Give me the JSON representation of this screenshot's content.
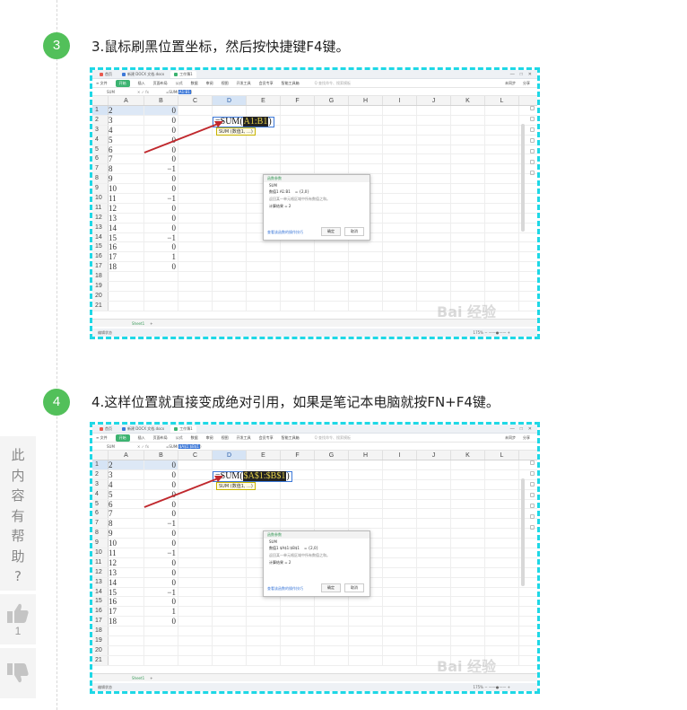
{
  "steps": [
    {
      "number": "3",
      "text": "3.鼠标刷黑位置坐标，然后按快捷键F4键。"
    },
    {
      "number": "4",
      "text": "4.这样位置就直接变成绝对引用，如果是笔记本电脑就按FN+F4键。"
    }
  ],
  "sheet": {
    "columns": [
      "A",
      "B",
      "C",
      "D",
      "E",
      "F",
      "G",
      "H",
      "I",
      "J",
      "K",
      "L"
    ],
    "rows": [
      {
        "n": "1",
        "a": "2",
        "b": "0"
      },
      {
        "n": "2",
        "a": "3",
        "b": "0"
      },
      {
        "n": "3",
        "a": "4",
        "b": "0"
      },
      {
        "n": "4",
        "a": "5",
        "b": "0"
      },
      {
        "n": "5",
        "a": "6",
        "b": "0"
      },
      {
        "n": "6",
        "a": "7",
        "b": "0"
      },
      {
        "n": "7",
        "a": "8",
        "b": "−1"
      },
      {
        "n": "8",
        "a": "9",
        "b": "0"
      },
      {
        "n": "9",
        "a": "10",
        "b": "0"
      },
      {
        "n": "10",
        "a": "11",
        "b": "−1"
      },
      {
        "n": "11",
        "a": "12",
        "b": "0"
      },
      {
        "n": "12",
        "a": "13",
        "b": "0"
      },
      {
        "n": "13",
        "a": "14",
        "b": "0"
      },
      {
        "n": "14",
        "a": "15",
        "b": "−1"
      },
      {
        "n": "15",
        "a": "16",
        "b": "0"
      },
      {
        "n": "16",
        "a": "17",
        "b": "1"
      },
      {
        "n": "17",
        "a": "18",
        "b": "0"
      },
      {
        "n": "18",
        "a": "",
        "b": ""
      },
      {
        "n": "19",
        "a": "",
        "b": ""
      },
      {
        "n": "20",
        "a": "",
        "b": ""
      },
      {
        "n": "21",
        "a": "",
        "b": ""
      }
    ],
    "sheet_tab": "Sheet1",
    "watermark": "Bai 经验",
    "dialog_title": "函数参数",
    "dialog_func": "SUM",
    "dialog_result": "计算结果 = 2",
    "dialog_ok": "确定",
    "dialog_cancel": "取消"
  },
  "shot1": {
    "formula": "=SUM(",
    "ref": "A1:B1",
    "close": ")",
    "formula_bar": "=SUM(A1:B1)",
    "tip": "SUM (数值1, ...)",
    "dialog_arg": "数值1  A1:B1"
  },
  "shot2": {
    "formula": "=SUM(",
    "ref": "$A$1:$B$1",
    "close": ")",
    "formula_bar": "=SUM($A$1:$B$1)",
    "tip": "SUM (数值1, ...)",
    "dialog_arg": "数值1  $A$1:$B$1"
  },
  "feedback": {
    "question": [
      "此",
      "内",
      "容",
      "有",
      "帮",
      "助",
      "?"
    ],
    "like_count": "1"
  },
  "colors": {
    "badge": "#52c05a",
    "frame": "#1ed8e6",
    "arrow": "#c0282d"
  }
}
